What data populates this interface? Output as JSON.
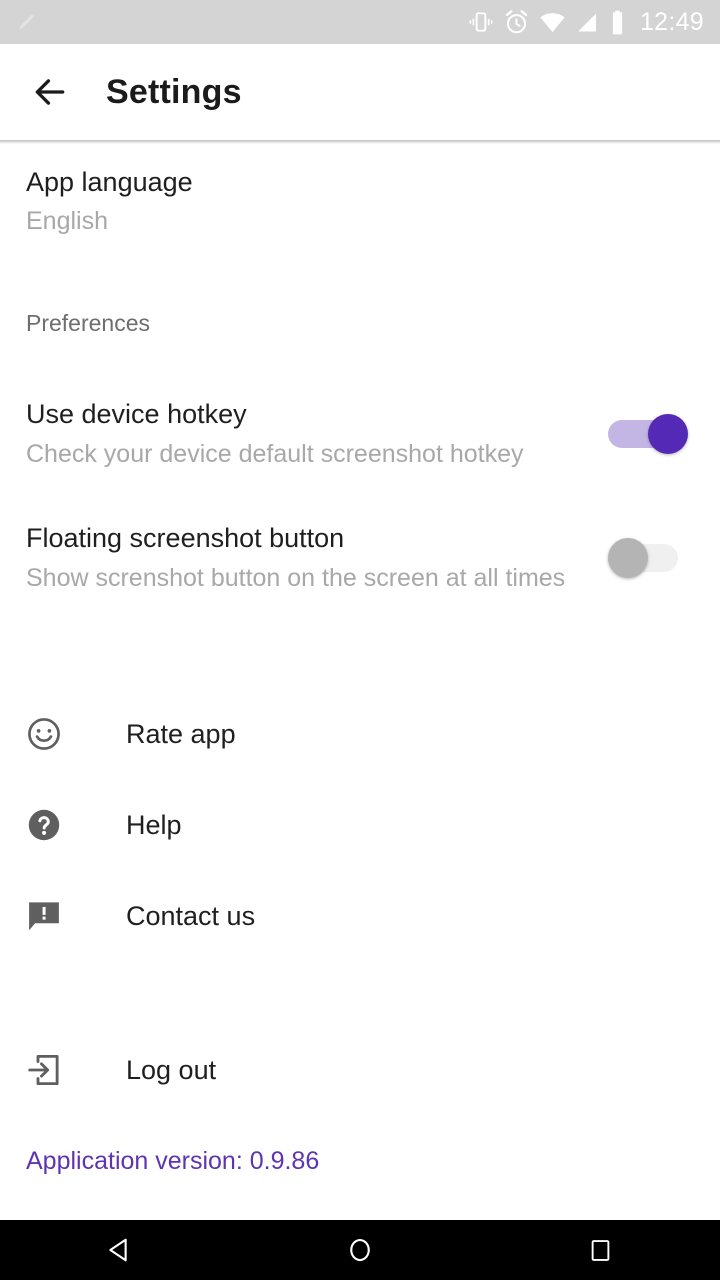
{
  "status_bar": {
    "left_icons": [
      {
        "name": "edit-pen-icon"
      }
    ],
    "right_icons": [
      {
        "name": "vibrate-icon"
      },
      {
        "name": "alarm-icon"
      },
      {
        "name": "wifi-icon"
      },
      {
        "name": "cell-signal-icon"
      },
      {
        "name": "battery-icon"
      }
    ],
    "time": "12:49",
    "background_color": "#d4d4d4",
    "icon_color": "#ffffff"
  },
  "toolbar": {
    "back_icon": "arrow-left-icon",
    "title": "Settings"
  },
  "settings": {
    "app_language": {
      "title": "App language",
      "value": "English"
    },
    "section_header": "Preferences",
    "toggles": [
      {
        "title": "Use device hotkey",
        "subtitle": "Check your device default screenshot hotkey",
        "state": "on",
        "track_color": "#c3b6e4",
        "thumb_color": "#5329b5"
      },
      {
        "title": "Floating screenshot button",
        "subtitle": "Show screnshot button on the screen at all times",
        "state": "off",
        "track_color": "#f0f0f0",
        "thumb_color": "#b4b4b4"
      }
    ],
    "actions": [
      {
        "icon": "smiley-face-icon",
        "label": "Rate app"
      },
      {
        "icon": "help-question-icon",
        "label": "Help"
      },
      {
        "icon": "feedback-message-icon",
        "label": "Contact us"
      }
    ],
    "logout": {
      "icon": "exit-to-app-icon",
      "label": "Log out"
    },
    "version": "Application version: 0.9.86",
    "version_color": "#5E35B1"
  },
  "nav_bar": {
    "back": "back-triangle-icon",
    "home": "home-circle-icon",
    "recents": "recents-square-icon",
    "background_color": "#000000"
  }
}
